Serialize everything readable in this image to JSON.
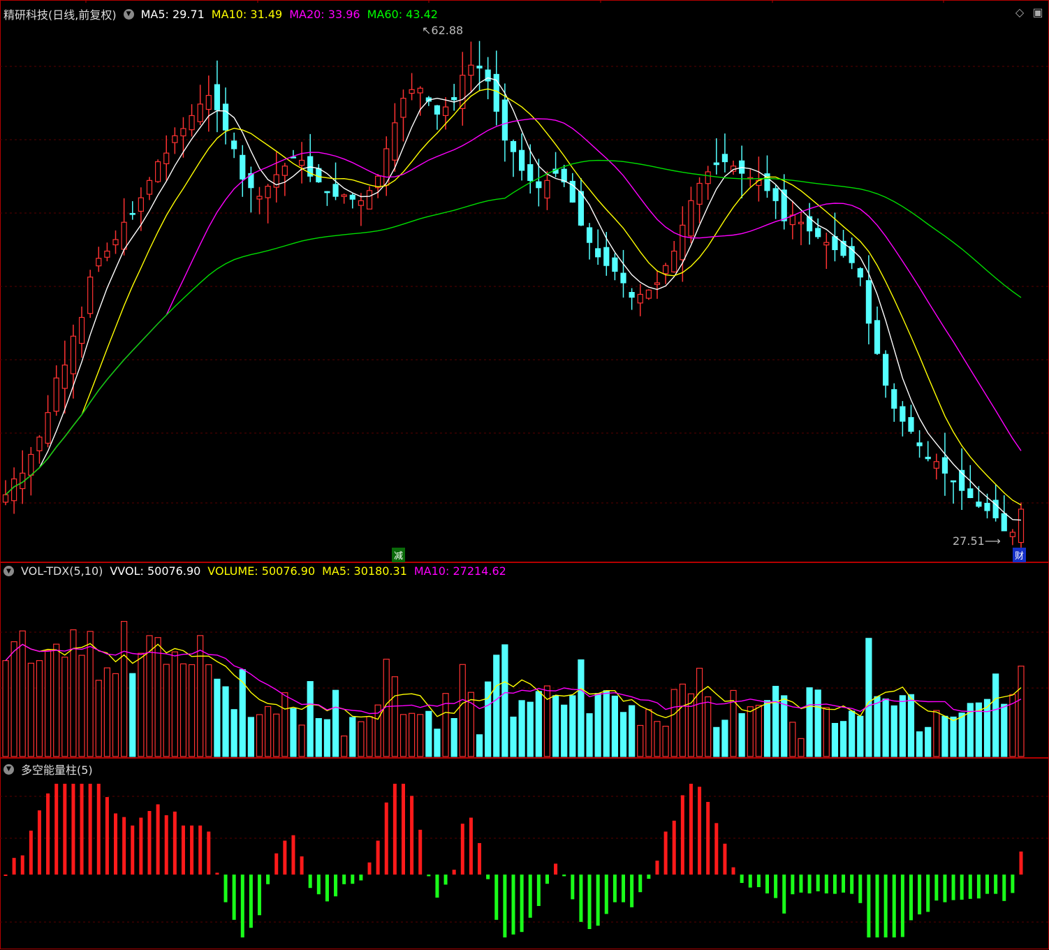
{
  "main_panel": {
    "title": "精研科技(日线,前复权)",
    "indicators": [
      {
        "label": "MA5: 29.71",
        "color": "#ffffff"
      },
      {
        "label": "MA10: 31.49",
        "color": "#ffff00"
      },
      {
        "label": "MA20: 33.96",
        "color": "#ff00ff"
      },
      {
        "label": "MA60: 43.42",
        "color": "#00ff00"
      }
    ],
    "high_label": "62.88",
    "low_label": "27.51",
    "event_tag": "减",
    "finance_tag": "财"
  },
  "volume_panel": {
    "title": "VOL-TDX(5,10)",
    "indicators": [
      {
        "label": "VVOL: 50076.90",
        "color": "#ffffff"
      },
      {
        "label": "VOLUME: 50076.90",
        "color": "#ffff00"
      },
      {
        "label": "MA5: 30180.31",
        "color": "#ffff00"
      },
      {
        "label": "MA10: 27214.62",
        "color": "#ff00ff"
      }
    ]
  },
  "energy_panel": {
    "title": "多空能量柱(5)"
  },
  "colors": {
    "up": "#ff3232",
    "down": "#54ffff",
    "ma5": "#ffffff",
    "ma10": "#ffff00",
    "ma20": "#ff00ff",
    "ma60": "#00dd00",
    "bull": "#ff1a1a",
    "bear": "#1aff1a",
    "border": "#b40000",
    "grid": "#5a0000"
  },
  "window_icons": [
    "diamond-icon",
    "maximize-icon"
  ],
  "chart_data": {
    "type": "candlestick",
    "price_range": [
      27.51,
      62.88
    ],
    "closes": [
      30.5,
      31.6,
      32.0,
      33.3,
      34.5,
      36.2,
      38.6,
      39.5,
      41.5,
      42.8,
      45.6,
      46.9,
      47.4,
      48.2,
      49.4,
      50.0,
      51.1,
      52.3,
      53.6,
      54.2,
      55.4,
      55.9,
      56.8,
      57.6,
      58.2,
      57.2,
      55.8,
      54.5,
      52.4,
      51.8,
      51.2,
      51.9,
      52.7,
      53.3,
      53.9,
      53.7,
      52.6,
      52.2,
      51.5,
      51.2,
      51.3,
      51.0,
      50.9,
      51.6,
      52.6,
      54.5,
      56.3,
      58.0,
      58.6,
      58.7,
      57.8,
      56.9,
      57.4,
      57.9,
      59.6,
      60.3,
      60.1,
      59.2,
      57.1,
      55.1,
      54.3,
      53.0,
      52.3,
      51.8,
      52.3,
      52.8,
      52.2,
      50.8,
      49.2,
      48.0,
      47.0,
      46.4,
      46.0,
      45.2,
      44.2,
      44.4,
      44.7,
      45.2,
      46.4,
      47.4,
      49.2,
      50.9,
      52.1,
      52.9,
      53.4,
      53.6,
      53.3,
      52.8,
      52.5,
      52.3,
      51.6,
      50.9,
      49.5,
      49.9,
      49.4,
      48.8,
      48.4,
      48.0,
      47.5,
      47.1,
      46.6,
      45.6,
      42.4,
      40.3,
      38.1,
      36.5,
      35.6,
      34.9,
      33.9,
      33.0,
      32.8,
      32.0,
      31.4,
      30.8,
      30.3,
      29.7,
      29.4,
      28.9,
      28.0,
      27.9,
      29.5
    ]
  }
}
